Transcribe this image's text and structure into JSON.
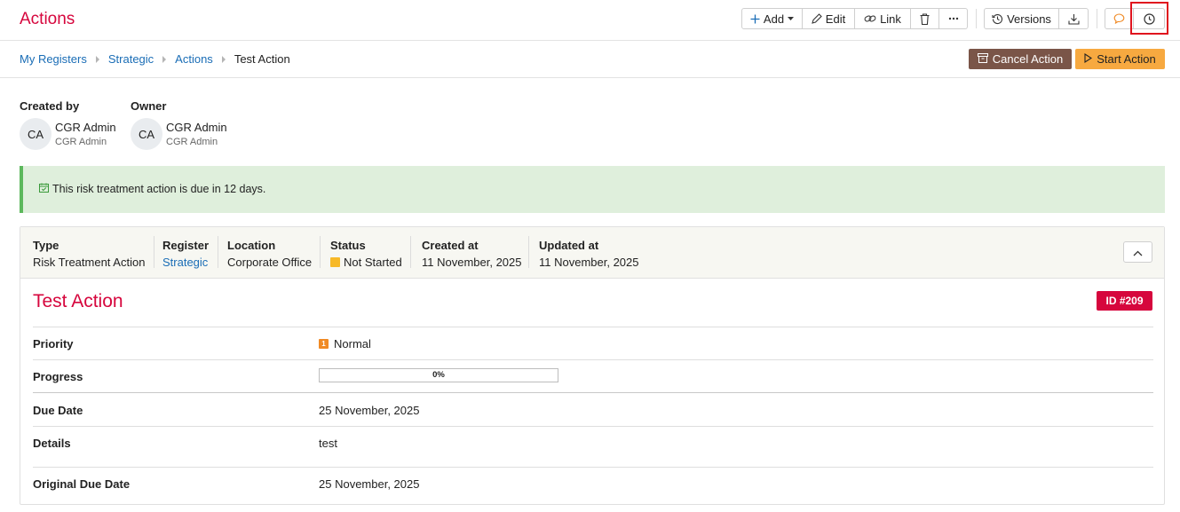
{
  "header": {
    "title": "Actions",
    "toolbar": {
      "add_label": "Add",
      "edit_label": "Edit",
      "link_label": "Link",
      "versions_label": "Versions"
    }
  },
  "breadcrumb": {
    "items": [
      "My Registers",
      "Strategic",
      "Actions"
    ],
    "current": "Test Action"
  },
  "actions": {
    "cancel_label": "Cancel Action",
    "start_label": "Start Action"
  },
  "people": {
    "created_by": {
      "label": "Created by",
      "initials": "CA",
      "name": "CGR Admin",
      "role": "CGR Admin"
    },
    "owner": {
      "label": "Owner",
      "initials": "CA",
      "name": "CGR Admin",
      "role": "CGR Admin"
    }
  },
  "alert": {
    "text": "This risk treatment action is due in 12 days."
  },
  "meta": {
    "type": {
      "label": "Type",
      "value": "Risk Treatment Action"
    },
    "register": {
      "label": "Register",
      "value": "Strategic"
    },
    "location": {
      "label": "Location",
      "value": "Corporate Office"
    },
    "status": {
      "label": "Status",
      "value": "Not Started",
      "color": "#f7b928"
    },
    "created_at": {
      "label": "Created at",
      "value": "11 November, 2025"
    },
    "updated_at": {
      "label": "Updated at",
      "value": "11 November, 2025"
    }
  },
  "record": {
    "title": "Test Action",
    "id_badge": "ID #209",
    "fields": {
      "priority": {
        "label": "Priority",
        "value": "Normal",
        "icon_text": "1"
      },
      "progress": {
        "label": "Progress",
        "value": "0%",
        "fraction": 0
      },
      "due_date": {
        "label": "Due Date",
        "value": "25 November, 2025"
      },
      "details": {
        "label": "Details",
        "value": "test"
      },
      "original_due_date": {
        "label": "Original Due Date",
        "value": "25 November, 2025"
      }
    }
  },
  "colors": {
    "brand": "#d6063d",
    "link": "#1a6db6",
    "cancel_bg": "#7a5548",
    "start_bg": "#f7a940",
    "alert_bg": "#dfefdc",
    "alert_border": "#5cb85c"
  }
}
